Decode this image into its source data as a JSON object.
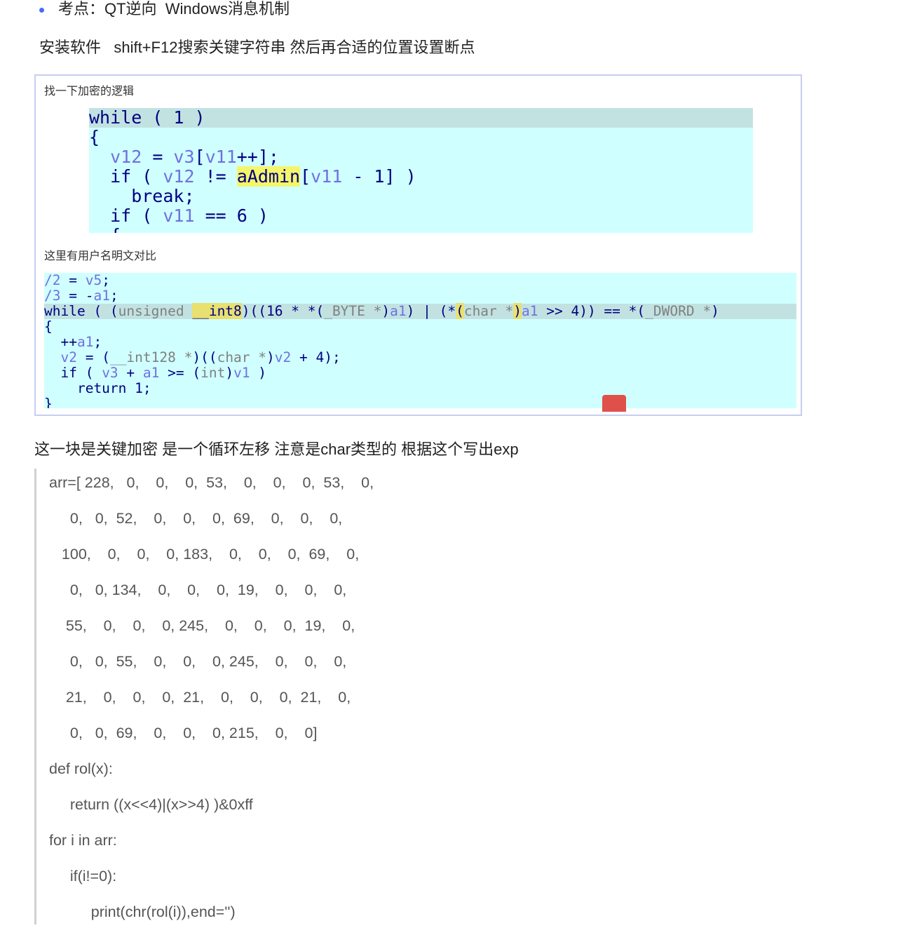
{
  "bullet": "考点：QT逆向  Windows消息机制",
  "intro": "安装软件   shift+F12搜索关键字符串 然后再合适的位置设置断点",
  "figure": {
    "caption1": "找一下加密的逻辑",
    "code1": [
      "while ( 1 )",
      "{",
      "  v12 = v3[v11++];",
      "  if ( v12 != aAdmin[v11 - 1] )",
      "    break;",
      "  if ( v11 == 6 )",
      "  {"
    ],
    "caption2": "这里有用户名明文对比",
    "code2": [
      "/2 = v5;",
      "/3 = -a1;",
      "while ( (unsigned __int8)((16 * *(_BYTE *)a1) | (*(char *)a1 >> 4)) == *(_DWORD *)",
      "{",
      "  ++a1;",
      "  v2 = (__int128 *)((char *)v2 + 4);",
      "  if ( v3 + a1 >= (int)v1 )",
      "    return 1;",
      "}"
    ]
  },
  "para": "这一块是关键加密 是一个循环左移 注意是char类型的 根据这个写出exp",
  "quote": [
    "arr=[ 228,   0,    0,    0,  53,    0,    0,    0,  53,    0,",
    "     0,   0,  52,    0,    0,    0,  69,    0,    0,    0,",
    "   100,    0,    0,    0, 183,    0,    0,    0,  69,    0,",
    "     0,   0, 134,    0,    0,    0,  19,    0,    0,    0,",
    "    55,    0,    0,    0, 245,    0,    0,    0,  19,    0,",
    "     0,   0,  55,    0,    0,    0, 245,    0,    0,    0,",
    "    21,    0,    0,    0,  21,    0,    0,    0,  21,    0,",
    "     0,   0,  69,    0,    0,    0, 215,    0,    0]",
    "def rol(x):",
    "     return ((x<<4)|(x>>4) )&0xff",
    "for i in arr:",
    "     if(i!=0):",
    "          print(chr(rol(i)),end='')"
  ]
}
